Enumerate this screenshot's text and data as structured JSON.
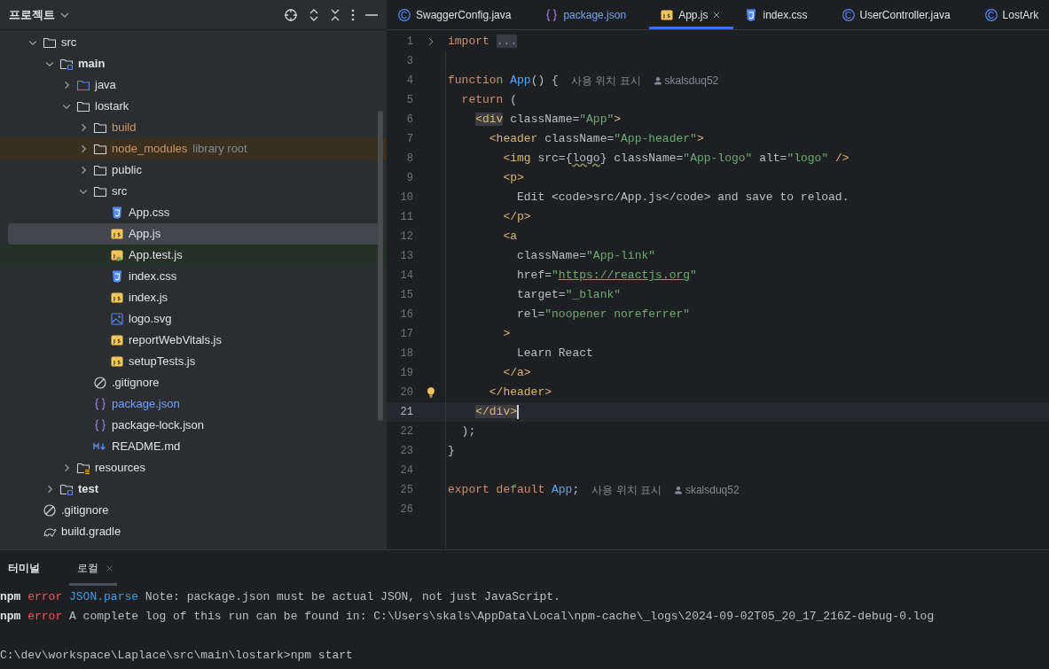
{
  "project_panel": {
    "title": "프로젝트",
    "tree": [
      {
        "name": "src",
        "kind": "folder",
        "expanded": true,
        "selected": false,
        "children": [
          {
            "name": "main",
            "kind": "module",
            "expanded": true,
            "selected": false,
            "children": [
              {
                "name": "java",
                "kind": "source",
                "expanded": false,
                "selected": false
              },
              {
                "name": "lostark",
                "kind": "folder",
                "expanded": true,
                "selected": false,
                "children": [
                  {
                    "name": "build",
                    "kind": "folder",
                    "excluded": true,
                    "expanded": false,
                    "selected": false
                  },
                  {
                    "name": "node_modules",
                    "kind": "folder",
                    "excluded": true,
                    "library_row": true,
                    "note": "library root",
                    "expanded": false,
                    "selected": false
                  },
                  {
                    "name": "public",
                    "kind": "folder",
                    "expanded": false,
                    "selected": false
                  },
                  {
                    "name": "src",
                    "kind": "folder",
                    "expanded": true,
                    "selected": false,
                    "children": [
                      {
                        "name": "App.css",
                        "kind": "css",
                        "selected": false
                      },
                      {
                        "name": "App.js",
                        "kind": "js",
                        "selected": true
                      },
                      {
                        "name": "App.test.js",
                        "kind": "jstest",
                        "test_row": true,
                        "selected": false
                      },
                      {
                        "name": "index.css",
                        "kind": "css",
                        "selected": false
                      },
                      {
                        "name": "index.js",
                        "kind": "js",
                        "selected": false
                      },
                      {
                        "name": "logo.svg",
                        "kind": "image",
                        "selected": false
                      },
                      {
                        "name": "reportWebVitals.js",
                        "kind": "js",
                        "selected": false
                      },
                      {
                        "name": "setupTests.js",
                        "kind": "js",
                        "selected": false
                      }
                    ]
                  },
                  {
                    "name": ".gitignore",
                    "kind": "ignore",
                    "selected": false
                  },
                  {
                    "name": "package.json",
                    "kind": "json",
                    "modified": true,
                    "selected": false
                  },
                  {
                    "name": "package-lock.json",
                    "kind": "json",
                    "selected": false
                  },
                  {
                    "name": "README.md",
                    "kind": "markdown",
                    "selected": false
                  }
                ]
              },
              {
                "name": "resources",
                "kind": "resources",
                "expanded": false,
                "selected": false
              }
            ]
          },
          {
            "name": "test",
            "kind": "module",
            "expanded": false,
            "selected": false
          }
        ]
      },
      {
        "name": ".gitignore",
        "kind": "ignore",
        "selected": false
      },
      {
        "name": "build.gradle",
        "kind": "gradle",
        "selected": false
      }
    ]
  },
  "editor_tabs": [
    {
      "label": "SwaggerConfig.java",
      "kind": "java",
      "selected": false
    },
    {
      "label": "package.json",
      "kind": "json",
      "modified": true,
      "selected": false
    },
    {
      "label": "App.js",
      "kind": "js",
      "selected": true,
      "closable": true
    },
    {
      "label": "index.css",
      "kind": "css",
      "selected": false
    },
    {
      "label": "UserController.java",
      "kind": "java",
      "selected": false
    },
    {
      "label": "LostArk",
      "kind": "java",
      "selected": false
    }
  ],
  "code_lines": [
    {
      "number": "1",
      "folded": true,
      "segments": [
        {
          "text": "import",
          "kind": "keyword"
        },
        {
          "text": "...",
          "kind": "fold"
        }
      ]
    },
    {
      "number": "3"
    },
    {
      "number": "4",
      "segments": [
        {
          "text": "function",
          "kind": "keyword"
        },
        {
          "text": " App",
          "kind": "function"
        },
        {
          "text": "() {",
          "kind": "plain"
        }
      ],
      "usages": "사용 위치 표시",
      "author": "skalsduq52"
    },
    {
      "number": "5",
      "segments": [
        {
          "text": "  return",
          "kind": "keyword"
        },
        {
          "text": " (",
          "kind": "plain"
        }
      ]
    },
    {
      "number": "6",
      "segments": [
        {
          "text": "    <div",
          "kind": "tag-match"
        },
        {
          "text": " className",
          "kind": "attr"
        },
        {
          "text": "=",
          "kind": "plain"
        },
        {
          "text": "\"App\"",
          "kind": "string"
        },
        {
          "text": ">",
          "kind": "tag"
        }
      ]
    },
    {
      "number": "7",
      "segments": [
        {
          "text": "      <header",
          "kind": "tag"
        },
        {
          "text": " className",
          "kind": "attr"
        },
        {
          "text": "=",
          "kind": "plain"
        },
        {
          "text": "\"App-header\"",
          "kind": "string"
        },
        {
          "text": ">",
          "kind": "tag"
        }
      ]
    },
    {
      "number": "8",
      "segments": [
        {
          "text": "        <img",
          "kind": "tag"
        },
        {
          "text": " src",
          "kind": "attr"
        },
        {
          "text": "={",
          "kind": "plain"
        },
        {
          "text": "logo",
          "kind": "warn"
        },
        {
          "text": "}",
          "kind": "plain"
        },
        {
          "text": " className",
          "kind": "attr"
        },
        {
          "text": "=",
          "kind": "plain"
        },
        {
          "text": "\"App-logo\"",
          "kind": "string"
        },
        {
          "text": " alt",
          "kind": "attr"
        },
        {
          "text": "=",
          "kind": "plain"
        },
        {
          "text": "\"logo\"",
          "kind": "string"
        },
        {
          "text": " />",
          "kind": "tag"
        }
      ]
    },
    {
      "number": "9",
      "segments": [
        {
          "text": "        <p>",
          "kind": "tag"
        }
      ]
    },
    {
      "number": "10",
      "segments": [
        {
          "text": "          Edit <code>src/App.js</code> and save to reload.",
          "kind": "plain"
        }
      ]
    },
    {
      "number": "11",
      "segments": [
        {
          "text": "        </p>",
          "kind": "tag"
        }
      ]
    },
    {
      "number": "12",
      "segments": [
        {
          "text": "        <a",
          "kind": "tag"
        }
      ]
    },
    {
      "number": "13",
      "segments": [
        {
          "text": "          className",
          "kind": "attr"
        },
        {
          "text": "=",
          "kind": "plain"
        },
        {
          "text": "\"App-link\"",
          "kind": "string"
        }
      ]
    },
    {
      "number": "14",
      "segments": [
        {
          "text": "          href",
          "kind": "attr"
        },
        {
          "text": "=",
          "kind": "plain"
        },
        {
          "text": "\"",
          "kind": "string"
        },
        {
          "text": "https://reactjs.org",
          "kind": "link"
        },
        {
          "text": "\"",
          "kind": "string"
        }
      ]
    },
    {
      "number": "15",
      "segments": [
        {
          "text": "          target",
          "kind": "attr"
        },
        {
          "text": "=",
          "kind": "plain"
        },
        {
          "text": "\"_blank\"",
          "kind": "string"
        }
      ]
    },
    {
      "number": "16",
      "segments": [
        {
          "text": "          rel",
          "kind": "attr"
        },
        {
          "text": "=",
          "kind": "plain"
        },
        {
          "text": "\"noopener noreferrer\"",
          "kind": "string"
        }
      ]
    },
    {
      "number": "17",
      "segments": [
        {
          "text": "        >",
          "kind": "tag"
        }
      ]
    },
    {
      "number": "18",
      "segments": [
        {
          "text": "          Learn React",
          "kind": "plain"
        }
      ]
    },
    {
      "number": "19",
      "segments": [
        {
          "text": "        </a>",
          "kind": "tag"
        }
      ]
    },
    {
      "number": "20",
      "bulb": true,
      "segments": [
        {
          "text": "      </header>",
          "kind": "tag"
        }
      ]
    },
    {
      "number": "21",
      "current": true,
      "segments": [
        {
          "text": "    </div>",
          "kind": "tag-match"
        }
      ]
    },
    {
      "number": "22",
      "segments": [
        {
          "text": "  );",
          "kind": "plain"
        }
      ]
    },
    {
      "number": "23",
      "segments": [
        {
          "text": "}",
          "kind": "plain"
        }
      ]
    },
    {
      "number": "24"
    },
    {
      "number": "25",
      "segments": [
        {
          "text": "export default",
          "kind": "keyword"
        },
        {
          "text": " App",
          "kind": "function"
        },
        {
          "text": ";",
          "kind": "plain"
        }
      ],
      "usages": "사용 위치 표시",
      "author": "skalsduq52"
    },
    {
      "number": "26"
    }
  ],
  "terminal": {
    "tabs": [
      {
        "label": "터미널",
        "selected": false
      },
      {
        "label": "로컬",
        "selected": true,
        "closable": true
      }
    ],
    "lines": [
      {
        "segments": [
          {
            "text": "npm",
            "kind": "bold"
          },
          {
            "text": " error",
            "kind": "error"
          },
          {
            "text": " JSON.parse",
            "kind": "info"
          },
          {
            "text": " Note: package.json must be actual JSON, not just JavaScript.",
            "kind": "plain"
          }
        ]
      },
      {
        "segments": [
          {
            "text": "npm",
            "kind": "bold"
          },
          {
            "text": " error",
            "kind": "error"
          },
          {
            "text": " A complete log of this run can be found in: C:\\Users\\skals\\AppData\\Local\\npm-cache\\_logs\\2024-09-02T05_20_17_216Z-debug-0.log",
            "kind": "plain"
          }
        ]
      },
      {
        "spaced": true,
        "segments": [
          {
            "text": "C:\\dev\\workspace\\Laplace\\src\\main\\lostark>npm start",
            "kind": "plain"
          }
        ]
      }
    ]
  }
}
